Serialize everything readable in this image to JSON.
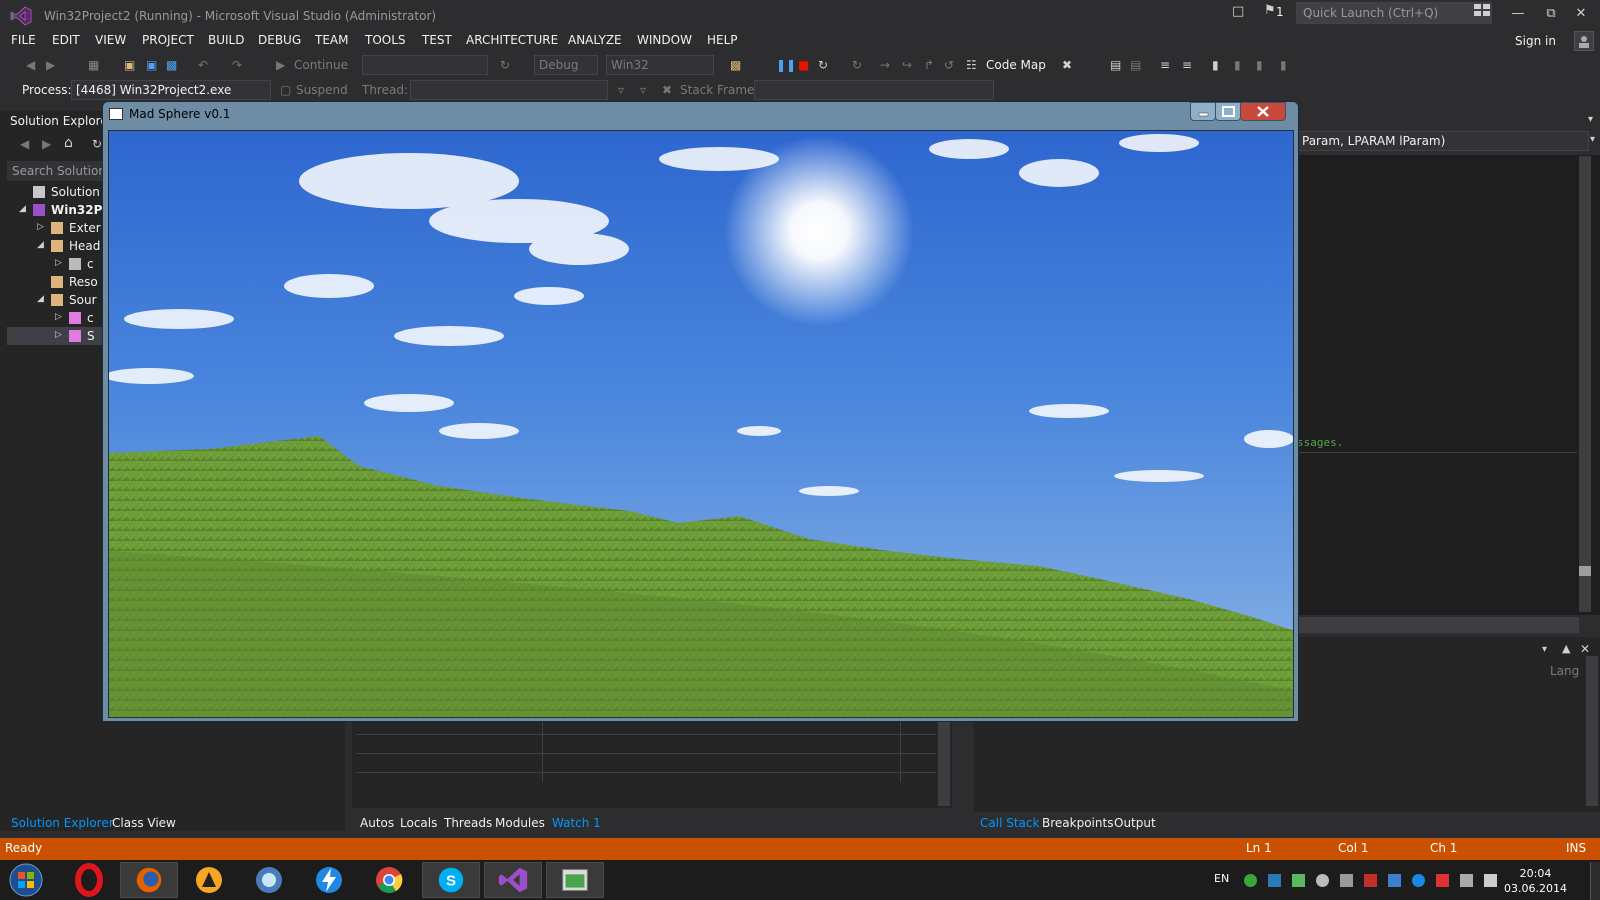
{
  "titlebar": {
    "title": "Win32Project2 (Running) - Microsoft Visual Studio (Administrator)",
    "notifications_count": "1",
    "quick_launch_placeholder": "Quick Launch (Ctrl+Q)"
  },
  "menu": [
    "FILE",
    "EDIT",
    "VIEW",
    "PROJECT",
    "BUILD",
    "DEBUG",
    "TEAM",
    "TOOLS",
    "TEST",
    "ARCHITECTURE",
    "ANALYZE",
    "WINDOW",
    "HELP"
  ],
  "sign_in": "Sign in",
  "toolbar": {
    "continue": "Continue",
    "config": "Debug",
    "platform": "Win32",
    "code_map": "Code Map"
  },
  "debug_toolbar": {
    "process_label": "Process:",
    "process_value": "[4468] Win32Project2.exe",
    "suspend": "Suspend",
    "thread_label": "Thread:",
    "stack_frame_label": "Stack Frame:"
  },
  "solution_explorer": {
    "title": "Solution Explorer",
    "search_placeholder": "Search Solution E",
    "items": [
      {
        "label": "Solution 'W",
        "indent": 0,
        "arrow": ""
      },
      {
        "label": "Win32P",
        "indent": 1,
        "arrow": "◢",
        "bold": true
      },
      {
        "label": "Exter",
        "indent": 2,
        "arrow": "▷"
      },
      {
        "label": "Head",
        "indent": 2,
        "arrow": "◢"
      },
      {
        "label": "c",
        "indent": 3,
        "arrow": "▷"
      },
      {
        "label": "Reso",
        "indent": 2,
        "arrow": ""
      },
      {
        "label": "Sour",
        "indent": 2,
        "arrow": "◢"
      },
      {
        "label": "c",
        "indent": 3,
        "arrow": "▷"
      },
      {
        "label": "S",
        "indent": 3,
        "arrow": "▷"
      }
    ]
  },
  "editor": {
    "signature_fragment": "Param, LPARAM lParam)",
    "code_fragment": "ssages."
  },
  "right_panel": {
    "lang_label": "Lang"
  },
  "bottom_tabs_left": [
    "Solution Explorer",
    "Class View"
  ],
  "bottom_tabs_mid": [
    "Autos",
    "Locals",
    "Threads",
    "Modules",
    "Watch 1"
  ],
  "bottom_tabs_right": [
    "Call Stack",
    "Breakpoints",
    "Output"
  ],
  "status": {
    "ready": "Ready",
    "ln": "Ln 1",
    "col": "Col 1",
    "ch": "Ch 1",
    "ins": "INS"
  },
  "app_window": {
    "title": "Mad Sphere v0.1"
  },
  "taskbar": {
    "lang": "EN",
    "time": "20:04",
    "date": "03.06.2014"
  },
  "colors": {
    "vs_bg": "#2d2d30",
    "status_orange": "#ca5100",
    "accent_blue": "#0097fb",
    "sky": "#3f79d9",
    "grass": "#6fa43a"
  }
}
